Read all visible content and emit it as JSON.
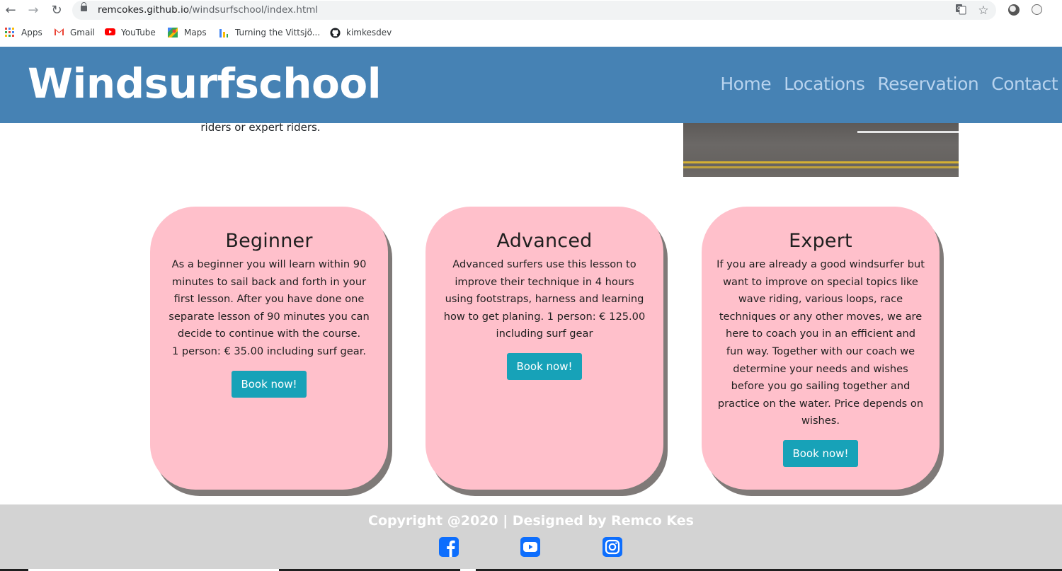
{
  "browser": {
    "url_host": "remcokes.github.io",
    "url_path": "/windsurfschool/index.html",
    "bookmarks": [
      "Apps",
      "Gmail",
      "YouTube",
      "Maps",
      "Turning the Vittsjö...",
      "kimkesdev"
    ],
    "icons": [
      "back-arrow",
      "forward-arrow",
      "reload",
      "lock",
      "translate",
      "star",
      "extension",
      "profile"
    ]
  },
  "header": {
    "brand": "Windsurfschool",
    "nav": [
      "Home",
      "Locations",
      "Reservation",
      "Contact"
    ]
  },
  "intro": {
    "text_tail": "riders or expert riders."
  },
  "cards": [
    {
      "title": "Beginner",
      "text": "As a beginner you will learn within 90 minutes to sail back and forth in your first lesson. After you have done one separate lesson of 90 minutes you can decide to continue with the course.",
      "price": "1 person: € 35.00 including surf gear.",
      "button": "Book now!"
    },
    {
      "title": "Advanced",
      "text": "Advanced surfers use this lesson to improve their technique in 4 hours using footstraps, harness and learning how to get planing. 1 person: € 125.00 including surf gear",
      "button": "Book now!"
    },
    {
      "title": "Expert",
      "text": "If you are already a good windsurfer but want to improve on special topics like wave riding, various loops, race techniques or any other moves, we are here to coach you in an efficient and fun way. Together with our coach we determine your needs and wishes before you go sailing together and practice on the water. Price depends on wishes.",
      "button": "Book now!"
    }
  ],
  "footer": {
    "copyright": "Copyright @2020 | Designed by Remco Kes",
    "social_icons": [
      "facebook-icon",
      "youtube-icon",
      "instagram-icon"
    ]
  },
  "colors": {
    "header_bg": "#4682b4",
    "card_bg": "#ffc0cb",
    "button_bg": "#17a2b8",
    "footer_bg": "#d3d3d3",
    "social_blue": "#0d6efd"
  }
}
